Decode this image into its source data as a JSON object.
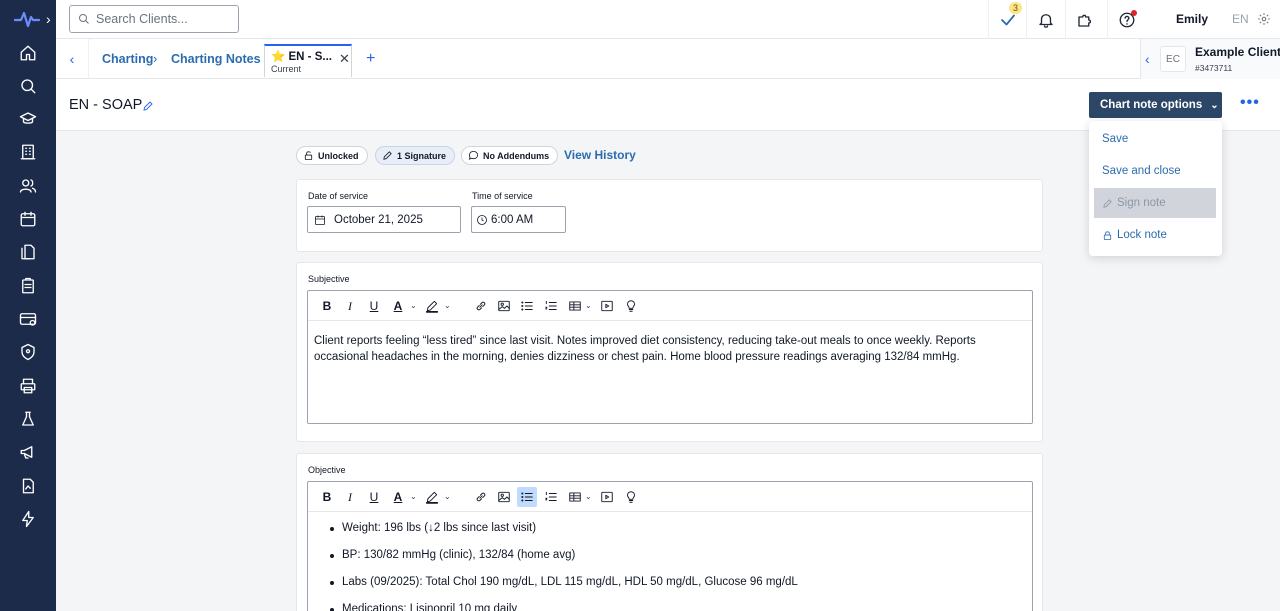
{
  "search": {
    "placeholder": "Search Clients..."
  },
  "topbar": {
    "tasks_count": "3",
    "user_name": "Emily",
    "language": "EN"
  },
  "tabs": {
    "breadcrumb": [
      "Charting",
      "Charting Notes"
    ],
    "active_title": "⭐ EN - S...",
    "active_sub": "Current",
    "close": "✕",
    "add": "+"
  },
  "client": {
    "initials": "EC",
    "name": "Example Client",
    "id": "#3473711"
  },
  "page": {
    "title": "EN - SOAP",
    "chart_options_label": "Chart note options"
  },
  "dropdown": {
    "save": "Save",
    "save_close": "Save and close",
    "sign": "Sign note",
    "lock": "Lock note"
  },
  "status": {
    "locked": "Unlocked",
    "signatures": "1 Signature",
    "addendums": "No Addendums",
    "history": "View History"
  },
  "service": {
    "date_label": "Date of service",
    "date_value": "October 21, 2025",
    "time_label": "Time of service",
    "time_value": "6:00 AM"
  },
  "subjective": {
    "label": "Subjective",
    "text": "Client reports feeling “less tired” since last visit. Notes improved diet consistency, reducing take-out meals to once weekly. Reports occasional headaches in the morning, denies dizziness or chest pain. Home blood pressure readings averaging 132/84 mmHg."
  },
  "objective": {
    "label": "Objective",
    "items": [
      "Weight: 196 lbs (↓2 lbs since last visit)",
      "BP: 130/82 mmHg (clinic), 132/84 (home avg)",
      "Labs (09/2025): Total Chol 190 mg/dL, LDL 115 mg/dL, HDL 50 mg/dL, Glucose 96 mg/dL",
      "Medications: Lisinopril 10 mg daily"
    ]
  },
  "colors": {
    "sidebar": "#1c2b4a",
    "primary_button": "#2c4667",
    "link": "#2b6cb0"
  }
}
